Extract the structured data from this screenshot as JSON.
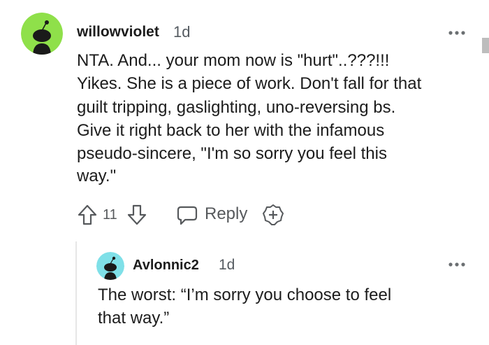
{
  "comment": {
    "author": "willowviolet",
    "age": "1d",
    "lines": [
      "NTA. And... your mom now is \"hurt\"..???!!!",
      "Yikes. She is a piece of work. Don't fall for that",
      "guilt tripping, gaslighting, uno-reversing bs.",
      "Give it right back to her with the infamous",
      "pseudo-sincere, \"I'm so sorry you feel this",
      "way.\""
    ],
    "vote_count": "11",
    "reply_label": "Reply",
    "avatar_color": "#8fe04a",
    "icons": [
      "upvote-icon",
      "downvote-icon",
      "reply-icon",
      "award-icon",
      "more-options-icon"
    ]
  },
  "reply": {
    "author": "Avlonnic2",
    "age": "1d",
    "lines": [
      "The worst: “I’m sorry you choose to feel",
      "that way.”"
    ],
    "avatar_color": "#7fe0e8"
  }
}
